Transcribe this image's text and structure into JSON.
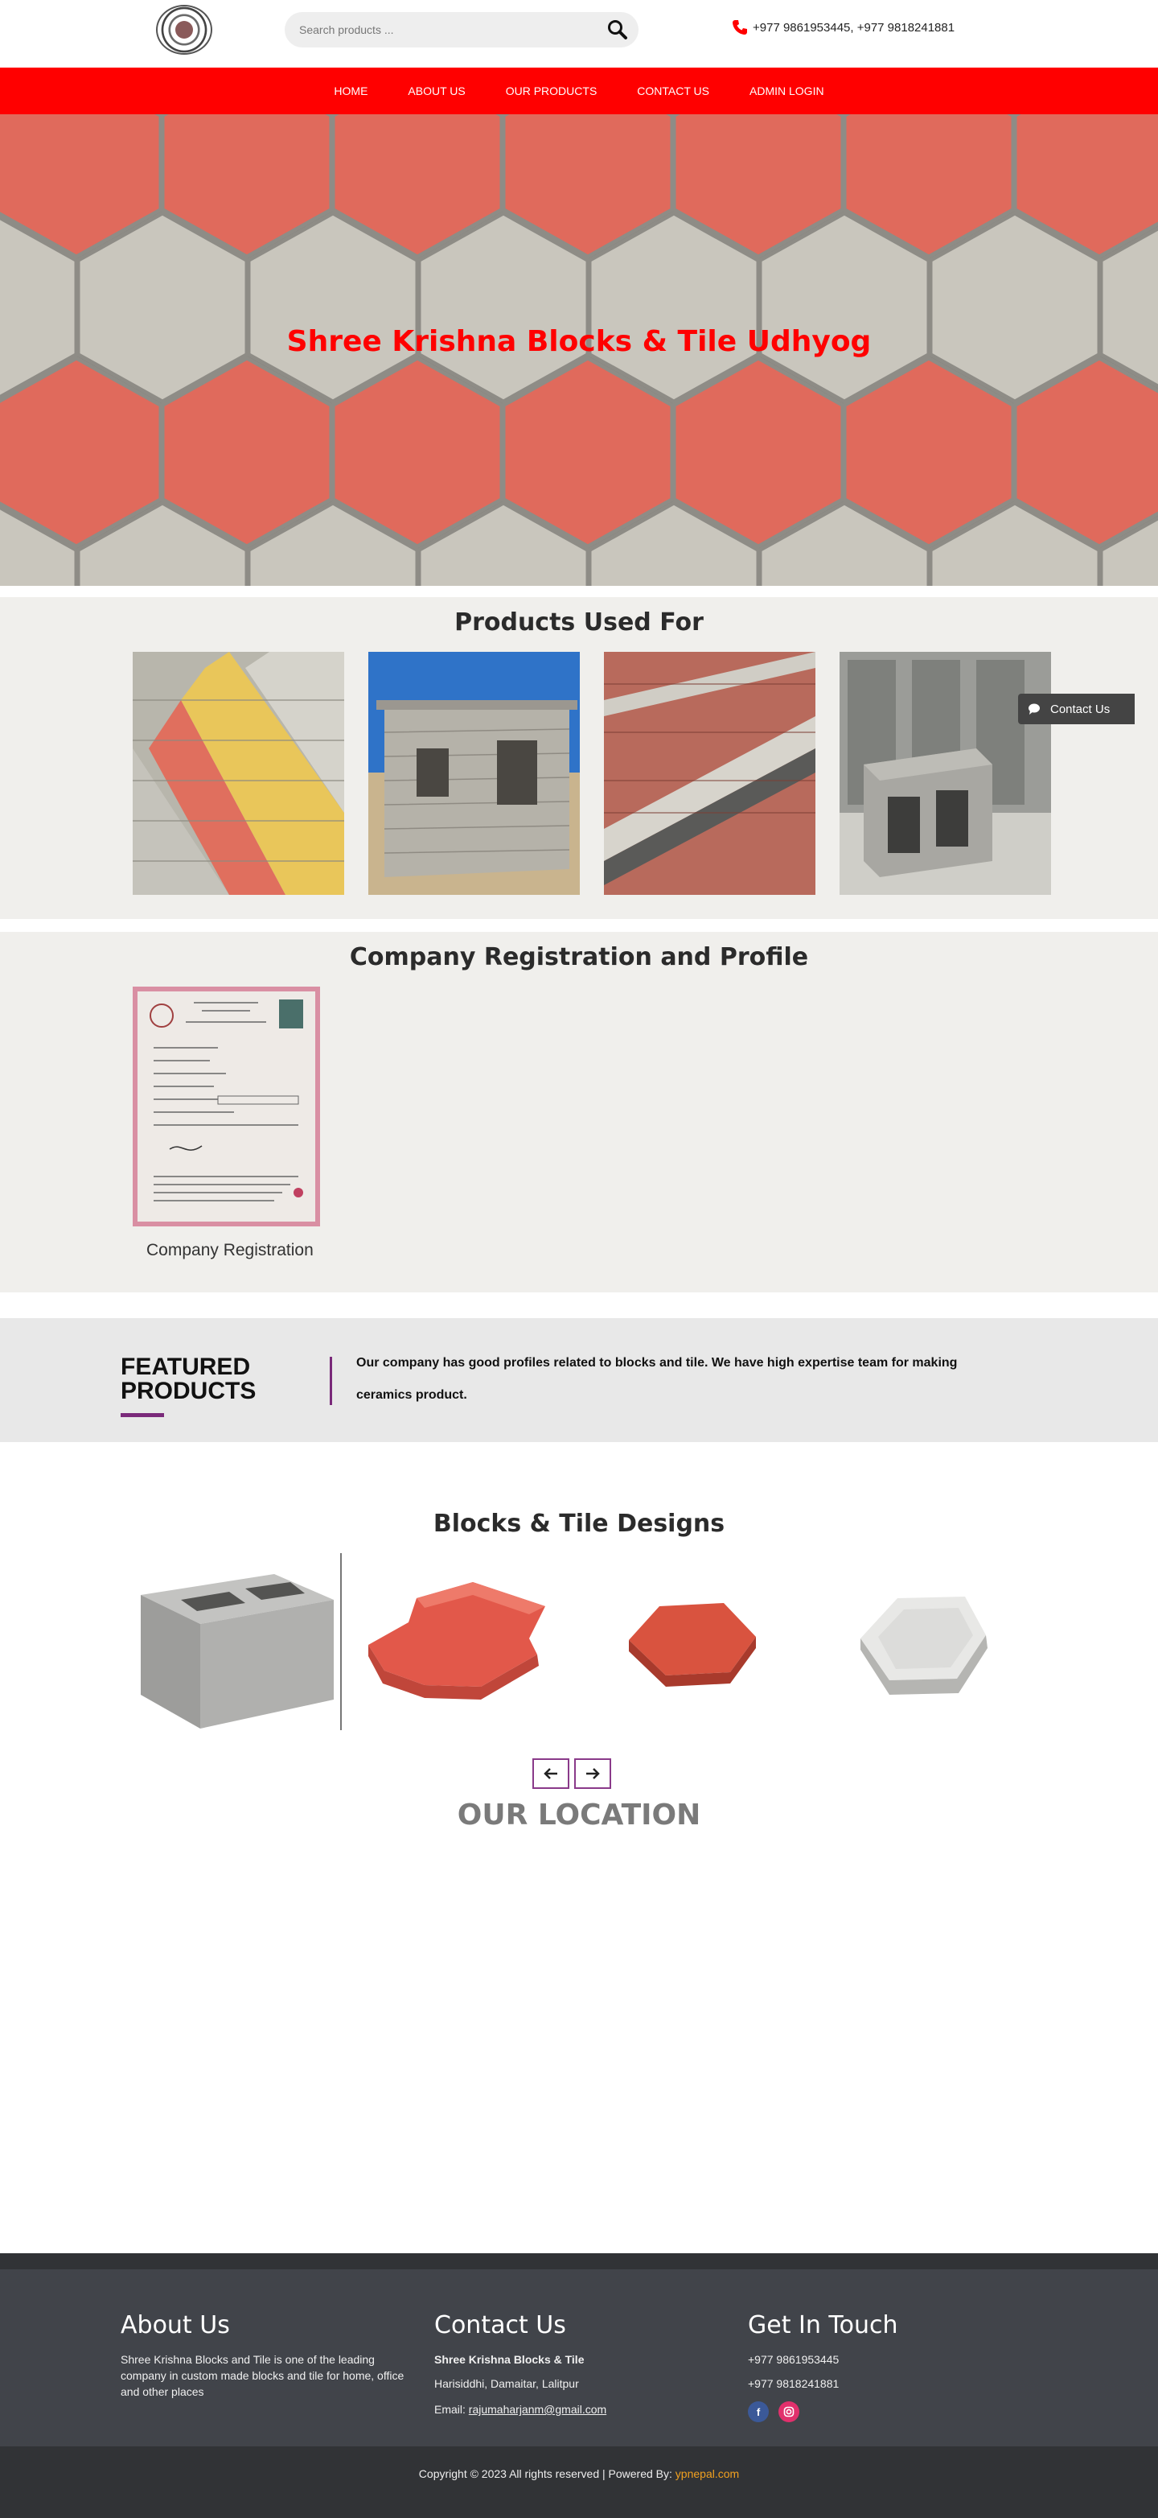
{
  "header": {
    "search_placeholder": "Search products ...",
    "phone": "+977 9861953445, +977 9818241881"
  },
  "nav": [
    "HOME",
    "ABOUT US",
    "OUR PRODUCTS",
    "CONTACT US",
    "ADMIN LOGIN"
  ],
  "hero": {
    "title": "Shree Krishna Blocks & Tile Udhyog"
  },
  "products_used": {
    "title": "Products Used For"
  },
  "contact_float": {
    "label": "Contact Us"
  },
  "registration": {
    "title": "Company Registration and Profile",
    "caption": "Company Registration"
  },
  "featured": {
    "title_line1": "FEATURED",
    "title_line2": "PRODUCTS",
    "text": "Our company has good profiles related to blocks and tile. We have high expertise team for making ceramics product."
  },
  "designs": {
    "title": "Blocks & Tile Designs"
  },
  "location": {
    "title": "OUR LOCATION"
  },
  "footer": {
    "about_title": "About Us",
    "about_text": "Shree Krishna Blocks and Tile is one of the leading company in custom made blocks and tile for home, office and other places",
    "contact_title": "Contact Us",
    "contact_name": "Shree Krishna Blocks & Tile",
    "contact_address": "Harisiddhi, Damaitar, Lalitpur",
    "contact_email_label": "Email:",
    "contact_email": "rajumaharjanm@gmail.com",
    "touch_title": "Get In Touch",
    "touch_phone1": "+977 9861953445",
    "touch_phone2": "+977 9818241881",
    "copyright": "Copyright © 2023 All rights reserved | Powered By:",
    "powered_by": "ypnepal.com"
  },
  "colors": {
    "brand_red": "#ff0000",
    "accent_purple": "#7a2a7a",
    "footer_bg": "#41444a"
  }
}
